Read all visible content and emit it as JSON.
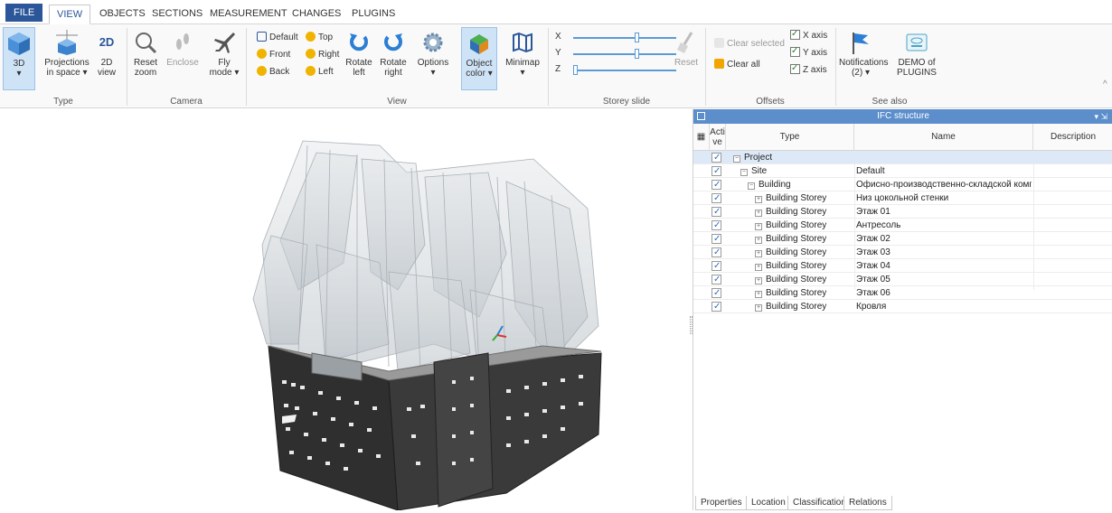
{
  "menu": {
    "tabs": [
      {
        "label": "FILE"
      },
      {
        "label": "VIEW"
      },
      {
        "label": "OBJECTS"
      },
      {
        "label": "SECTIONS"
      },
      {
        "label": "MEASUREMENT"
      },
      {
        "label": "CHANGES"
      },
      {
        "label": "PLUGINS"
      }
    ],
    "active": "VIEW"
  },
  "ribbon": {
    "type_group": {
      "label": "Type",
      "btn_3d": "3D",
      "btn_projections_l1": "Projections",
      "btn_projections_l2": "in space",
      "btn_2d_l1": "2D",
      "btn_2d_l2": "view",
      "icon_2d": "2D"
    },
    "camera_group": {
      "label": "Camera",
      "reset_l1": "Reset",
      "reset_l2": "zoom",
      "enclose": "Enclose",
      "fly_l1": "Fly",
      "fly_l2": "mode"
    },
    "view_group": {
      "label": "View",
      "default": "Default",
      "top": "Top",
      "front": "Front",
      "right": "Right",
      "back": "Back",
      "left": "Left",
      "rotate_left_l1": "Rotate",
      "rotate_left_l2": "left",
      "rotate_right_l1": "Rotate",
      "rotate_right_l2": "right",
      "options": "Options",
      "object_color_l1": "Object",
      "object_color_l2": "color",
      "minimap": "Minimap"
    },
    "storey_group": {
      "label": "Storey slide",
      "x": "X",
      "y": "Y",
      "z": "Z",
      "x_level": 0.6,
      "y_level": 0.6,
      "z_level": 0.0,
      "reset": "Reset"
    },
    "offsets_group": {
      "label": "Offsets",
      "clear_selected": "Clear selected",
      "clear_all": "Clear all",
      "x_axis": "X axis",
      "y_axis": "Y axis",
      "z_axis": "Z axis"
    },
    "see_also_group": {
      "label": "See also",
      "notifications_l1": "Notifications",
      "notifications_l2": "(2)",
      "demo_l1": "DEMO of",
      "demo_l2": "PLUGINS"
    }
  },
  "ifc_panel": {
    "title": "IFC structure",
    "columns": {
      "active_l1": "Acti",
      "active_l2": "ve",
      "type": "Type",
      "name": "Name",
      "description": "Description"
    },
    "rows": [
      {
        "type": "Project",
        "name": "",
        "level": 0
      },
      {
        "type": "Site",
        "name": "Default",
        "level": 1
      },
      {
        "type": "Building",
        "name": "Офисно-производственно-складской компле...",
        "level": 2
      },
      {
        "type": "Building Storey",
        "name": "Низ цокольной стенки",
        "level": 3
      },
      {
        "type": "Building Storey",
        "name": "Этаж 01",
        "level": 3
      },
      {
        "type": "Building Storey",
        "name": "Антресоль",
        "level": 3
      },
      {
        "type": "Building Storey",
        "name": "Этаж 02",
        "level": 3
      },
      {
        "type": "Building Storey",
        "name": "Этаж 03",
        "level": 3
      },
      {
        "type": "Building Storey",
        "name": "Этаж 04",
        "level": 3
      },
      {
        "type": "Building Storey",
        "name": "Этаж 05",
        "level": 3
      },
      {
        "type": "Building Storey",
        "name": "Этаж 06",
        "level": 3
      },
      {
        "type": "Building Storey",
        "name": "Кровля",
        "level": 3
      }
    ],
    "bottom_tabs": [
      {
        "label": "Properties"
      },
      {
        "label": "Location"
      },
      {
        "label": "Classification"
      },
      {
        "label": "Relations"
      }
    ]
  },
  "colors": {
    "accent": "#2b579a",
    "panel_title": "#5b8ecb",
    "building_dark": "#2f2f2f",
    "selection": "#cfe3f6"
  }
}
